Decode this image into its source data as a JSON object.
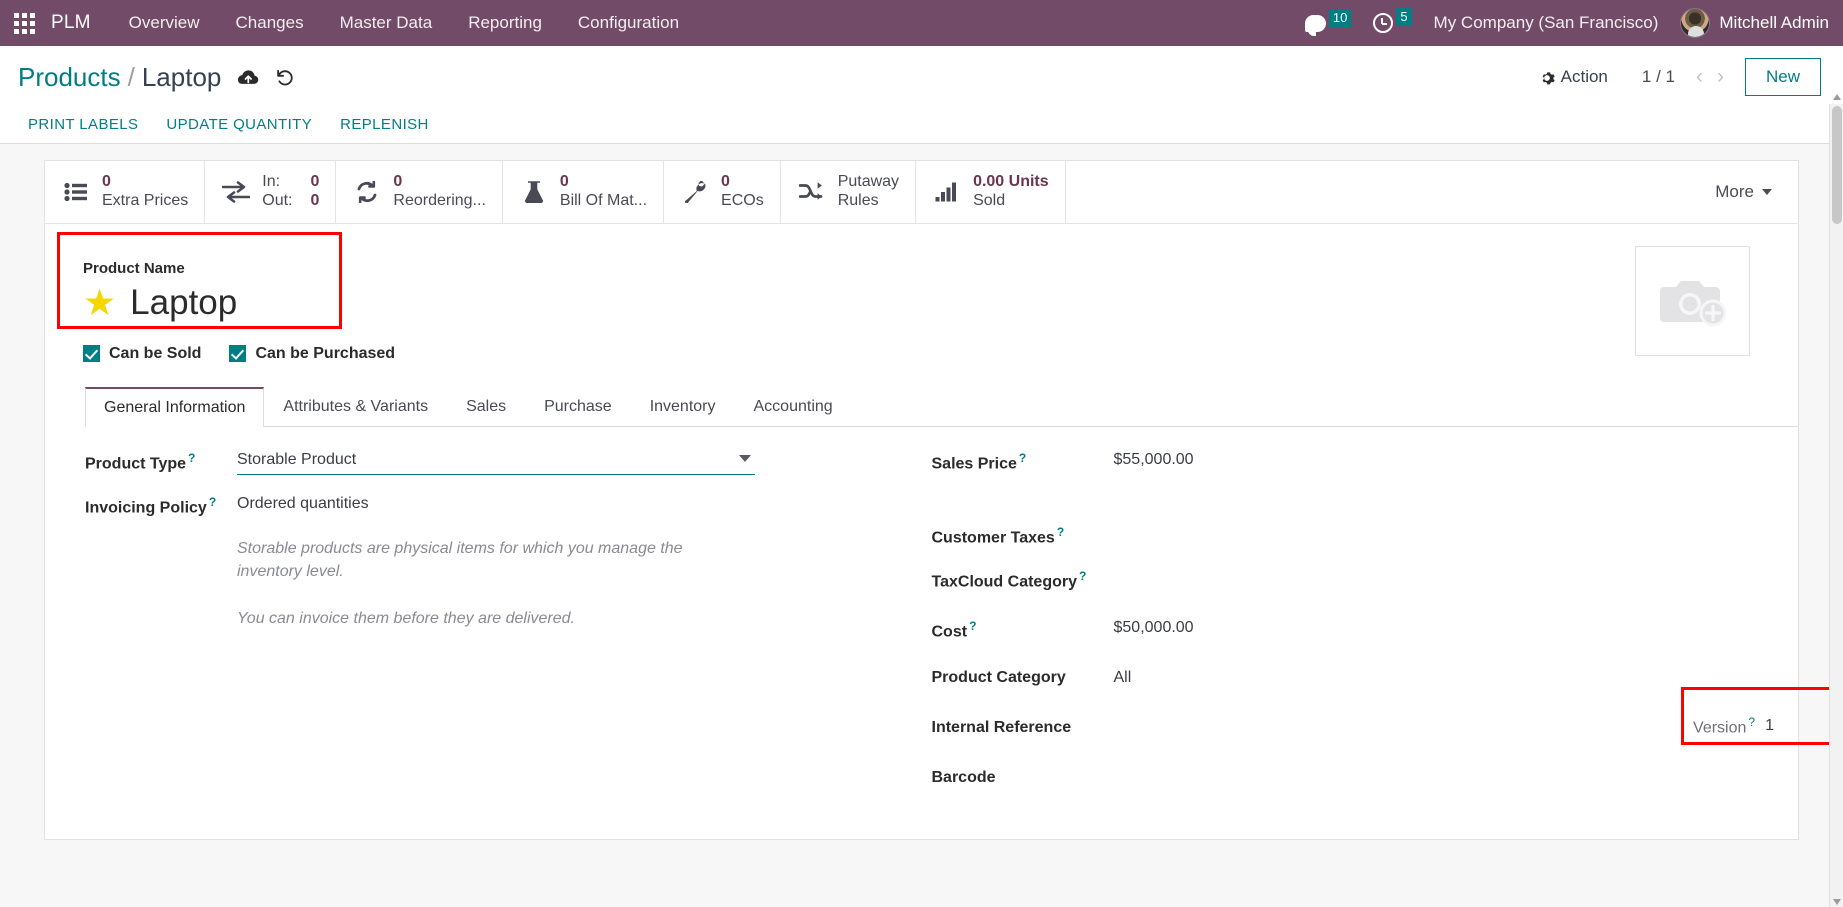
{
  "navbar": {
    "apps_icon": "apps-grid-icon",
    "brand": "PLM",
    "menu": [
      {
        "label": "Overview"
      },
      {
        "label": "Changes"
      },
      {
        "label": "Master Data"
      },
      {
        "label": "Reporting"
      },
      {
        "label": "Configuration"
      }
    ],
    "messages_icon": "chat-bubble-icon",
    "messages_count": "10",
    "activities_icon": "clock-icon",
    "activities_count": "5",
    "company": "My Company (San Francisco)",
    "user": "Mitchell Admin",
    "brand_color": "#714B67",
    "badge_color": "#017e84"
  },
  "breadcrumb": {
    "root": "Products",
    "separator": "/",
    "current": "Laptop",
    "save_icon": "cloud-upload-icon",
    "discard_icon": "undo-icon"
  },
  "control_panel": {
    "action_label": "Action",
    "gear_icon": "gear-icon",
    "pager": "1 / 1",
    "prev_icon": "chevron-left-icon",
    "next_icon": "chevron-right-icon",
    "new_label": "New"
  },
  "action_buttons": [
    {
      "label": "PRINT LABELS"
    },
    {
      "label": "UPDATE QUANTITY"
    },
    {
      "label": "REPLENISH"
    }
  ],
  "stat_buttons": [
    {
      "icon": "list-ul-icon",
      "value": "0",
      "label": "Extra Prices"
    },
    {
      "icon": "exchange-arrows-icon",
      "in_label": "In:",
      "in_value": "0",
      "out_label": "Out:",
      "out_value": "0"
    },
    {
      "icon": "refresh-icon",
      "value": "0",
      "label": "Reordering..."
    },
    {
      "icon": "flask-icon",
      "value": "0",
      "label": "Bill Of Mat..."
    },
    {
      "icon": "wrench-icon",
      "value": "0",
      "label": "ECOs"
    },
    {
      "icon": "shuffle-icon",
      "value": "",
      "label": "Putaway Rules"
    },
    {
      "icon": "bar-chart-icon",
      "value": "0.00 Units",
      "label": "Sold"
    }
  ],
  "more_button": {
    "label": "More",
    "icon": "caret-down-icon"
  },
  "product": {
    "name_label": "Product Name",
    "favorite_icon": "star-icon",
    "name": "Laptop",
    "can_be_sold_label": "Can be Sold",
    "can_be_sold": true,
    "can_be_purchased_label": "Can be Purchased",
    "can_be_purchased": true,
    "image_placeholder_icon": "camera-add-icon"
  },
  "tabs": [
    {
      "label": "General Information",
      "active": true
    },
    {
      "label": "Attributes & Variants",
      "active": false
    },
    {
      "label": "Sales",
      "active": false
    },
    {
      "label": "Purchase",
      "active": false
    },
    {
      "label": "Inventory",
      "active": false
    },
    {
      "label": "Accounting",
      "active": false
    }
  ],
  "general_information": {
    "left": {
      "product_type_label": "Product Type",
      "product_type_value": "Storable Product",
      "invoicing_policy_label": "Invoicing Policy",
      "invoicing_policy_value": "Ordered quantities",
      "help_note_1": "Storable products are physical items for which you manage the inventory level.",
      "help_note_2": "You can invoice them before they are delivered."
    },
    "right": {
      "sales_price_label": "Sales Price",
      "sales_price_value": "$55,000.00",
      "customer_taxes_label": "Customer Taxes",
      "customer_taxes_value": "",
      "taxcloud_category_label": "TaxCloud Category",
      "taxcloud_category_value": "",
      "cost_label": "Cost",
      "cost_value": "$50,000.00",
      "product_category_label": "Product Category",
      "product_category_value": "All",
      "internal_reference_label": "Internal Reference",
      "internal_reference_value": "",
      "barcode_label": "Barcode",
      "barcode_value": "",
      "version_label": "Version",
      "version_value": "1"
    }
  },
  "highlights": {
    "color": "#ff0000",
    "product_name_box": true,
    "version_box": true
  },
  "help_marker": "?"
}
